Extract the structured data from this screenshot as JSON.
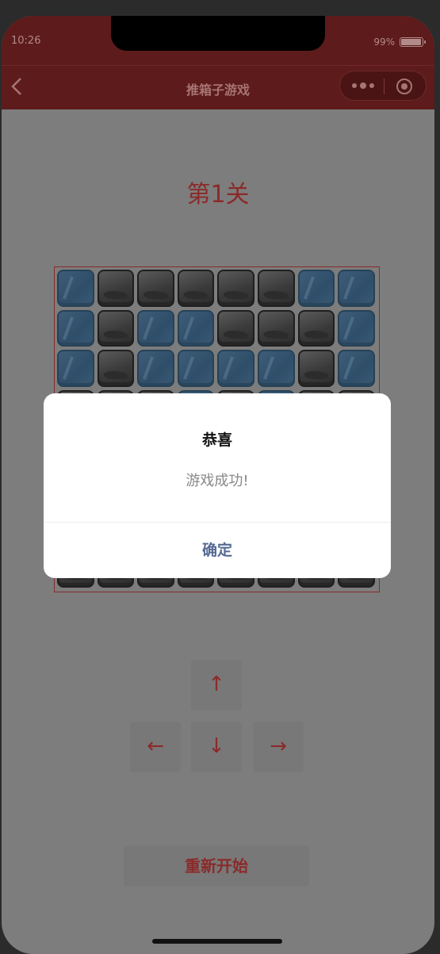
{
  "status_bar": {
    "time": "10:26",
    "battery_percent": "99%",
    "battery_level": 0.99
  },
  "nav": {
    "title": "推箱子游戏",
    "back_icon": "chevron-left-icon",
    "more_icon": "more-dots-icon",
    "close_icon": "target-close-icon"
  },
  "game": {
    "level_title": "第1关",
    "board": [
      [
        "floor",
        "wall",
        "wall",
        "wall",
        "wall",
        "wall",
        "floor",
        "floor"
      ],
      [
        "floor",
        "wall",
        "floor",
        "floor",
        "wall",
        "wall",
        "wall",
        "floor"
      ],
      [
        "floor",
        "wall",
        "floor",
        "floor",
        "floor",
        "floor",
        "wall",
        "floor"
      ],
      [
        "wall",
        "wall",
        "wall",
        "floor",
        "wall",
        "floor",
        "wall",
        "wall"
      ],
      [
        "wall",
        "floor",
        "floor",
        "floor",
        "floor",
        "floor",
        "floor",
        "wall"
      ],
      [
        "wall",
        "floor",
        "floor",
        "floor",
        "floor",
        "floor",
        "floor",
        "wall"
      ],
      [
        "wall",
        "floor",
        "floor",
        "floor",
        "floor",
        "floor",
        "floor",
        "wall"
      ],
      [
        "wall",
        "wall",
        "wall",
        "wall",
        "wall",
        "wall",
        "wall",
        "wall"
      ]
    ],
    "controls": {
      "up": "↑",
      "left": "←",
      "down": "↓",
      "right": "→"
    },
    "restart_label": "重新开始"
  },
  "dialog": {
    "title": "恭喜",
    "content": "游戏成功!",
    "confirm_label": "确定"
  },
  "colors": {
    "accent": "#8b2a2a",
    "header_bg": "#5d1b1b",
    "confirm": "#576b95"
  }
}
